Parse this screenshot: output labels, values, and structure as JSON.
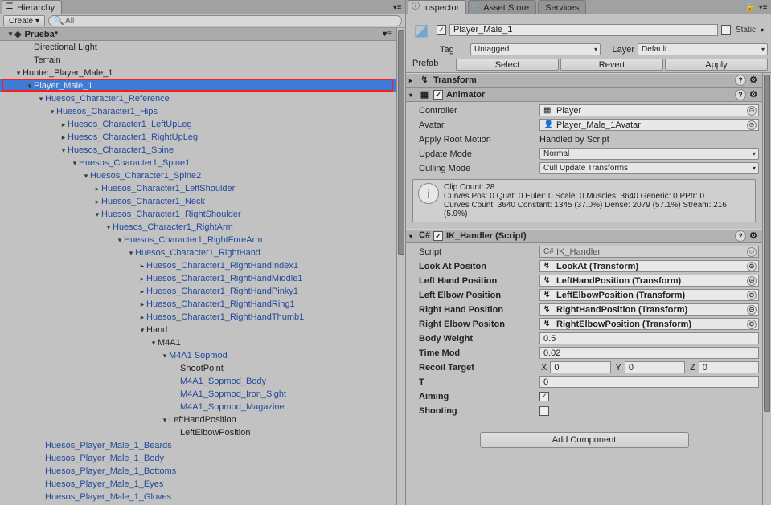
{
  "tabs": {
    "hierarchy": "Hierarchy",
    "inspector": "Inspector",
    "assetstore": "Asset Store",
    "services": "Services"
  },
  "toolbar": {
    "create": "Create",
    "search_placeholder": "All"
  },
  "scene_name": "Prueba*",
  "hierarchy": [
    {
      "t": "Directional Light",
      "d": 1,
      "p": false,
      "a": ""
    },
    {
      "t": "Terrain",
      "d": 1,
      "p": false,
      "a": ""
    },
    {
      "t": "Hunter_Player_Male_1",
      "d": 0,
      "p": false,
      "a": "▾"
    },
    {
      "t": "Player_Male_1",
      "d": 1,
      "p": true,
      "a": "▾",
      "sel": true,
      "hl": true
    },
    {
      "t": "Huesos_Character1_Reference",
      "d": 2,
      "p": true,
      "a": "▾"
    },
    {
      "t": "Huesos_Character1_Hips",
      "d": 3,
      "p": true,
      "a": "▾"
    },
    {
      "t": "Huesos_Character1_LeftUpLeg",
      "d": 4,
      "p": true,
      "a": "▸"
    },
    {
      "t": "Huesos_Character1_RightUpLeg",
      "d": 4,
      "p": true,
      "a": "▸"
    },
    {
      "t": "Huesos_Character1_Spine",
      "d": 4,
      "p": true,
      "a": "▾"
    },
    {
      "t": "Huesos_Character1_Spine1",
      "d": 5,
      "p": true,
      "a": "▾"
    },
    {
      "t": "Huesos_Character1_Spine2",
      "d": 6,
      "p": true,
      "a": "▾"
    },
    {
      "t": "Huesos_Character1_LeftShoulder",
      "d": 7,
      "p": true,
      "a": "▸"
    },
    {
      "t": "Huesos_Character1_Neck",
      "d": 7,
      "p": true,
      "a": "▸"
    },
    {
      "t": "Huesos_Character1_RightShoulder",
      "d": 7,
      "p": true,
      "a": "▾"
    },
    {
      "t": "Huesos_Character1_RightArm",
      "d": 8,
      "p": true,
      "a": "▾"
    },
    {
      "t": "Huesos_Character1_RightForeArm",
      "d": 9,
      "p": true,
      "a": "▾"
    },
    {
      "t": "Huesos_Character1_RightHand",
      "d": 10,
      "p": true,
      "a": "▾"
    },
    {
      "t": "Huesos_Character1_RightHandIndex1",
      "d": 11,
      "p": true,
      "a": "▸"
    },
    {
      "t": "Huesos_Character1_RightHandMiddle1",
      "d": 11,
      "p": true,
      "a": "▸"
    },
    {
      "t": "Huesos_Character1_RightHandPinky1",
      "d": 11,
      "p": true,
      "a": "▸"
    },
    {
      "t": "Huesos_Character1_RightHandRing1",
      "d": 11,
      "p": true,
      "a": "▸"
    },
    {
      "t": "Huesos_Character1_RightHandThumb1",
      "d": 11,
      "p": true,
      "a": "▸"
    },
    {
      "t": "Hand",
      "d": 11,
      "p": false,
      "a": "▾"
    },
    {
      "t": "M4A1",
      "d": 12,
      "p": false,
      "a": "▾"
    },
    {
      "t": "M4A1 Sopmod",
      "d": 13,
      "p": true,
      "a": "▾"
    },
    {
      "t": "ShootPoint",
      "d": 14,
      "p": false,
      "a": ""
    },
    {
      "t": "M4A1_Sopmod_Body",
      "d": 14,
      "p": true,
      "a": ""
    },
    {
      "t": "M4A1_Sopmod_Iron_Sight",
      "d": 14,
      "p": true,
      "a": ""
    },
    {
      "t": "M4A1_Sopmod_Magazine",
      "d": 14,
      "p": true,
      "a": ""
    },
    {
      "t": "LeftHandPosition",
      "d": 13,
      "p": false,
      "a": "▾"
    },
    {
      "t": "LeftElbowPosition",
      "d": 14,
      "p": false,
      "a": ""
    },
    {
      "t": "Huesos_Player_Male_1_Beards",
      "d": 2,
      "p": true,
      "a": ""
    },
    {
      "t": "Huesos_Player_Male_1_Body",
      "d": 2,
      "p": true,
      "a": ""
    },
    {
      "t": "Huesos_Player_Male_1_Bottoms",
      "d": 2,
      "p": true,
      "a": ""
    },
    {
      "t": "Huesos_Player_Male_1_Eyes",
      "d": 2,
      "p": true,
      "a": ""
    },
    {
      "t": "Huesos_Player_Male_1_Gloves",
      "d": 2,
      "p": true,
      "a": ""
    }
  ],
  "inspector": {
    "name": "Player_Male_1",
    "static_label": "Static",
    "tag_label": "Tag",
    "tag_value": "Untagged",
    "layer_label": "Layer",
    "layer_value": "Default",
    "prefab_label": "Prefab",
    "prefab_select": "Select",
    "prefab_revert": "Revert",
    "prefab_apply": "Apply"
  },
  "transform": {
    "title": "Transform"
  },
  "animator": {
    "title": "Animator",
    "controller_label": "Controller",
    "controller_value": "Player",
    "avatar_label": "Avatar",
    "avatar_value": "Player_Male_1Avatar",
    "apply_root_label": "Apply Root Motion",
    "apply_root_value": "Handled by Script",
    "update_mode_label": "Update Mode",
    "update_mode_value": "Normal",
    "culling_mode_label": "Culling Mode",
    "culling_mode_value": "Cull Update Transforms",
    "info_line1": "Clip Count: 28",
    "info_line2": "Curves Pos: 0 Quat: 0 Euler: 0 Scale: 0 Muscles: 3640 Generic: 0 PPtr: 0",
    "info_line3": "Curves Count: 3640 Constant: 1345 (37.0%) Dense: 2079 (57.1%) Stream: 216 (5.9%)"
  },
  "ik": {
    "title": "IK_Handler (Script)",
    "script_label": "Script",
    "script_value": "IK_Handler",
    "look_at_label": "Look At Positon",
    "look_at_value": "LookAt (Transform)",
    "lhp_label": "Left Hand Position",
    "lhp_value": "LeftHandPosition (Transform)",
    "lep_label": "Left Elbow Position",
    "lep_value": "LeftElbowPosition (Transform)",
    "rhp_label": "Right Hand Position",
    "rhp_value": "RightHandPosition (Transform)",
    "rep_label": "Right Elbow Positon",
    "rep_value": "RightElbowPosition (Transform)",
    "bw_label": "Body Weight",
    "bw_value": "0.5",
    "tm_label": "Time Mod",
    "tm_value": "0.02",
    "rt_label": "Recoil Target",
    "rt_x": "0",
    "rt_y": "0",
    "rt_z": "0",
    "t_label": "T",
    "t_value": "0",
    "aiming_label": "Aiming",
    "shooting_label": "Shooting"
  },
  "add_component": "Add Component"
}
